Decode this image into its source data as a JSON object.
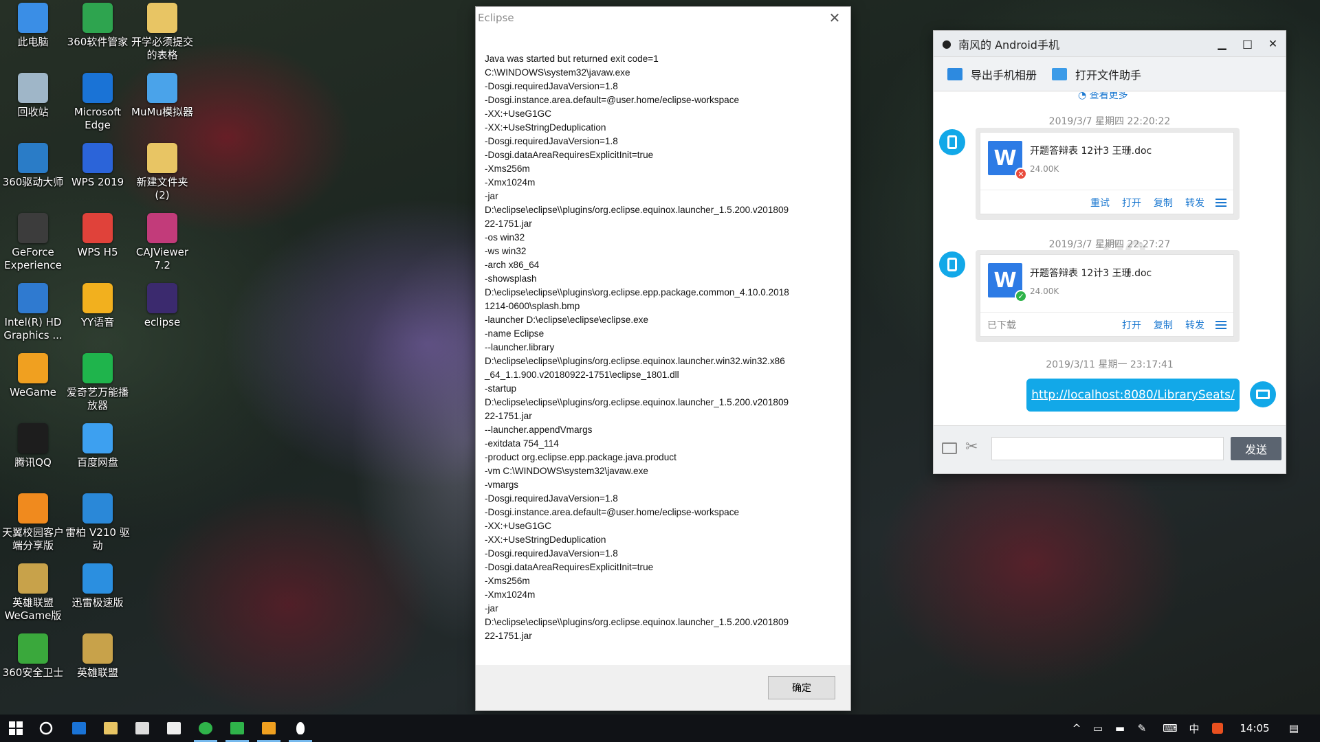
{
  "desktop": {
    "icons": [
      {
        "label": "此电脑",
        "icon": "computer-icon",
        "color": "#3a8ee6"
      },
      {
        "label": "360软件管家",
        "icon": "app-store-icon",
        "color": "#2ea44f"
      },
      {
        "label": "开学必须提交的表格",
        "icon": "folder-icon",
        "color": "#e8c564"
      },
      {
        "label": "回收站",
        "icon": "recycle-bin-icon",
        "color": "#9fb6c8"
      },
      {
        "label": "Microsoft Edge",
        "icon": "edge-icon",
        "color": "#1a73d6"
      },
      {
        "label": "MuMu模拟器",
        "icon": "emulator-icon",
        "color": "#4aa3ea"
      },
      {
        "label": "360驱动大师",
        "icon": "gear-icon",
        "color": "#2a7cc7"
      },
      {
        "label": "WPS 2019",
        "icon": "wps-icon",
        "color": "#2b64d9"
      },
      {
        "label": "新建文件夹 (2)",
        "icon": "folder-icon",
        "color": "#e8c564"
      },
      {
        "label": "GeForce Experience",
        "icon": "nvidia-icon",
        "color": "#3c3c3c"
      },
      {
        "label": "WPS H5",
        "icon": "wps-h5-icon",
        "color": "#e0423a"
      },
      {
        "label": "CAJViewer 7.2",
        "icon": "reader-icon",
        "color": "#c23b7a"
      },
      {
        "label": "Intel(R) HD Graphics ...",
        "icon": "intel-icon",
        "color": "#2f7ad0"
      },
      {
        "label": "YY语音",
        "icon": "yy-icon",
        "color": "#f2b01e"
      },
      {
        "label": "eclipse",
        "icon": "eclipse-icon",
        "color": "#3b2a6e"
      },
      {
        "label": "WeGame",
        "icon": "wegame-icon",
        "color": "#f0a020"
      },
      {
        "label": "爱奇艺万能播放器",
        "icon": "iqiyi-icon",
        "color": "#1fb44c"
      },
      {
        "label": "腾讯QQ",
        "icon": "qq-icon",
        "color": "#1d1d1d"
      },
      {
        "label": "百度网盘",
        "icon": "cloud-icon",
        "color": "#3da0f0"
      },
      {
        "label": "天翼校园客户端分享版",
        "icon": "campus-icon",
        "color": "#f08a1e"
      },
      {
        "label": "雷柏 V210 驱动",
        "icon": "mouse-driver-icon",
        "color": "#2a88d8"
      },
      {
        "label": "英雄联盟 WeGame版",
        "icon": "lol-icon",
        "color": "#c8a24a"
      },
      {
        "label": "迅雷极速版",
        "icon": "thunder-icon",
        "color": "#2b8fe0"
      },
      {
        "label": "360安全卫士",
        "icon": "shield-icon",
        "color": "#3aa83c"
      },
      {
        "label": "英雄联盟",
        "icon": "lol-icon",
        "color": "#c8a24a"
      }
    ]
  },
  "eclipse_dialog": {
    "title": "Eclipse",
    "lines": [
      "Java was started but returned exit code=1",
      "C:\\WINDOWS\\system32\\javaw.exe",
      "-Dosgi.requiredJavaVersion=1.8",
      "-Dosgi.instance.area.default=@user.home/eclipse-workspace",
      "-XX:+UseG1GC",
      "-XX:+UseStringDeduplication",
      "-Dosgi.requiredJavaVersion=1.8",
      "-Dosgi.dataAreaRequiresExplicitInit=true",
      "-Xms256m",
      "-Xmx1024m",
      "-jar",
      "D:\\eclipse\\eclipse\\\\plugins/org.eclipse.equinox.launcher_1.5.200.v201809",
      "22-1751.jar",
      "-os win32",
      "-ws win32",
      "-arch x86_64",
      "-showsplash",
      "D:\\eclipse\\eclipse\\\\plugins\\org.eclipse.epp.package.common_4.10.0.2018",
      "1214-0600\\splash.bmp",
      "-launcher D:\\eclipse\\eclipse\\eclipse.exe",
      "-name Eclipse",
      "--launcher.library",
      "D:\\eclipse\\eclipse\\\\plugins/org.eclipse.equinox.launcher.win32.win32.x86",
      "_64_1.1.900.v20180922-1751\\eclipse_1801.dll",
      "-startup",
      "D:\\eclipse\\eclipse\\\\plugins/org.eclipse.equinox.launcher_1.5.200.v201809",
      "22-1751.jar",
      "--launcher.appendVmargs",
      "-exitdata 754_114",
      "-product org.eclipse.epp.package.java.product",
      "-vm C:\\WINDOWS\\system32\\javaw.exe",
      "-vmargs",
      "-Dosgi.requiredJavaVersion=1.8",
      "-Dosgi.instance.area.default=@user.home/eclipse-workspace",
      "-XX:+UseG1GC",
      "-XX:+UseStringDeduplication",
      "-Dosgi.requiredJavaVersion=1.8",
      "-Dosgi.dataAreaRequiresExplicitInit=true",
      "-Xms256m",
      "-Xmx1024m",
      "-jar",
      "D:\\eclipse\\eclipse\\\\plugins/org.eclipse.equinox.launcher_1.5.200.v201809",
      "22-1751.jar"
    ],
    "ok_label": "确定"
  },
  "qq_window": {
    "title": "南风的 Android手机",
    "toolbar": {
      "export_album": "导出手机相册",
      "open_file_helper": "打开文件助手"
    },
    "see_more": "查看更多",
    "watermark": "QQ",
    "messages": [
      {
        "timestamp": "2019/3/7 星期四 22:20:22",
        "file_name": "开题答辩表  12计3 王珊.doc",
        "file_size": "24.00K",
        "status": "failed",
        "actions": [
          "重试",
          "打开",
          "复制",
          "转发"
        ]
      },
      {
        "timestamp": "2019/3/7 星期四 22:27:27",
        "file_name": "开题答辩表  12计3 王珊.doc",
        "file_size": "24.00K",
        "status": "downloaded",
        "status_text": "已下载",
        "actions": [
          "打开",
          "复制",
          "转发"
        ]
      },
      {
        "timestamp": "2019/3/11 星期一 23:17:41",
        "url": "http://localhost:8080/LibrarySeats/"
      }
    ],
    "input_placeholder": "",
    "send_label": "发送"
  },
  "taskbar": {
    "tray_ime": "中",
    "clock": "14:05"
  },
  "colors": {
    "qq_accent": "#12a8e8",
    "link_blue": "#1b78d0",
    "taskbar_bg": "#101216"
  }
}
